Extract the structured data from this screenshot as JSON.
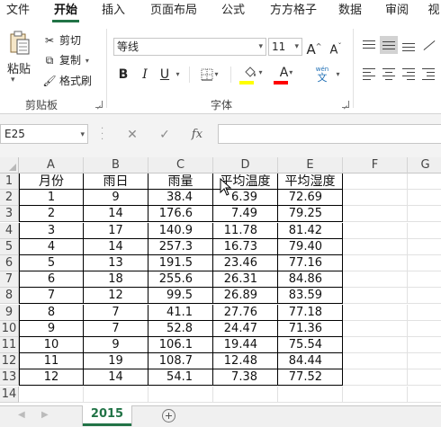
{
  "ribbon_tabs": [
    "文件",
    "开始",
    "插入",
    "页面布局",
    "公式",
    "方方格子",
    "数据",
    "审阅",
    "视"
  ],
  "active_tab": "开始",
  "clipboard": {
    "paste": "粘贴",
    "cut": "剪切",
    "copy": "复制",
    "copy_arrow": "▾",
    "format_painter": "格式刷",
    "group_label": "剪贴板"
  },
  "font": {
    "name": "等线",
    "size": "11",
    "grow": "A",
    "shrink": "A",
    "bold": "B",
    "italic": "I",
    "underline": "U",
    "font_color_letter": "A",
    "phonetic_top": "wén",
    "phonetic_bottom": "文",
    "group_label": "字体",
    "highlight_color": "#ffff00",
    "font_color": "#ff0000"
  },
  "formula_bar": {
    "name_box": "E25",
    "cancel": "✕",
    "enter": "✓",
    "fx": "fx",
    "content": ""
  },
  "columns": [
    "A",
    "B",
    "C",
    "D",
    "E",
    "F",
    "G"
  ],
  "rows": [
    "1",
    "2",
    "3",
    "4",
    "5",
    "6",
    "7",
    "8",
    "9",
    "10",
    "11",
    "12",
    "13",
    "14"
  ],
  "table": {
    "headers": [
      "月份",
      "雨日",
      "雨量",
      "平均温度",
      "平均湿度"
    ],
    "data": [
      [
        "1",
        "9",
        "38.4",
        "6.39",
        "72.69"
      ],
      [
        "2",
        "14",
        "176.6",
        "7.49",
        "79.25"
      ],
      [
        "3",
        "17",
        "140.9",
        "11.78",
        "81.42"
      ],
      [
        "4",
        "14",
        "257.3",
        "16.73",
        "79.40"
      ],
      [
        "5",
        "13",
        "191.5",
        "23.46",
        "77.16"
      ],
      [
        "6",
        "18",
        "255.6",
        "26.31",
        "84.86"
      ],
      [
        "7",
        "12",
        "99.5",
        "26.89",
        "83.59"
      ],
      [
        "8",
        "7",
        "41.1",
        "27.76",
        "77.18"
      ],
      [
        "9",
        "7",
        "52.8",
        "24.47",
        "71.36"
      ],
      [
        "10",
        "9",
        "106.1",
        "19.44",
        "75.54"
      ],
      [
        "11",
        "19",
        "108.7",
        "12.48",
        "84.44"
      ],
      [
        "12",
        "14",
        "54.1",
        "7.38",
        "77.52"
      ]
    ]
  },
  "sheet_tabs": [
    "2015"
  ],
  "accent_color": "#217346"
}
